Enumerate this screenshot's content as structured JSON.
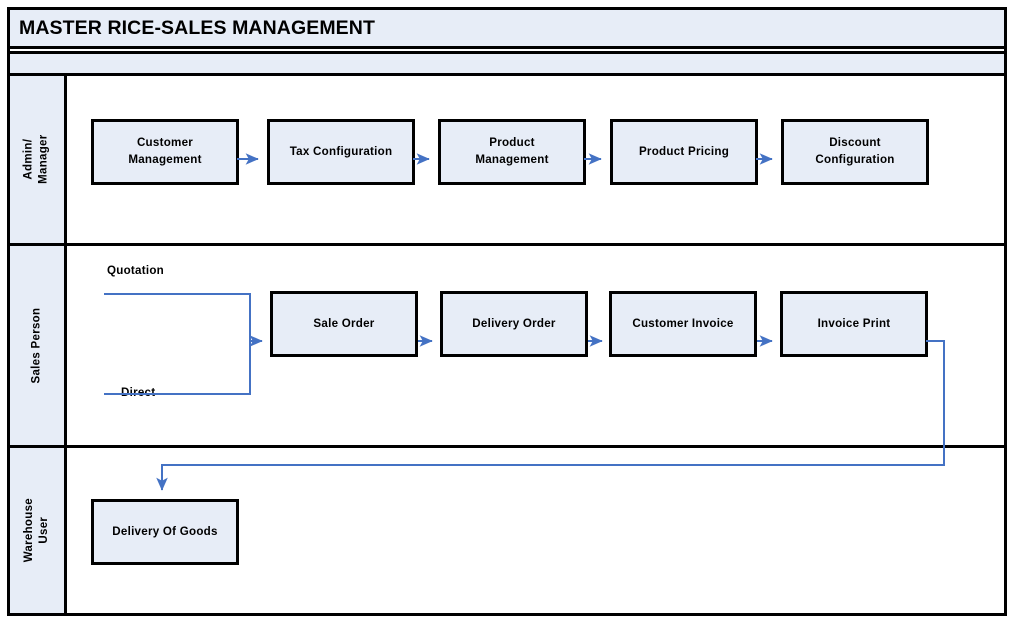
{
  "header": {
    "title": "MASTER RICE-SALES MANAGEMENT"
  },
  "colors": {
    "node_fill": "#E7EDF7",
    "node_border": "#000000",
    "connector": "#4472C4",
    "band_fill": "#E7EDF7",
    "page_background": "#FFFFFF"
  },
  "lanes": [
    {
      "id": "admin-manager",
      "label": "Admin/\nManager",
      "nodes": [
        {
          "id": "customer-management",
          "label": "Customer\nManagement"
        },
        {
          "id": "tax-configuration",
          "label": "Tax Configuration"
        },
        {
          "id": "product-management",
          "label": "Product\nManagement"
        },
        {
          "id": "product-pricing",
          "label": "Product Pricing"
        },
        {
          "id": "discount-configuration",
          "label": "Discount\nConfiguration"
        }
      ]
    },
    {
      "id": "sales-person",
      "label": "Sales Person",
      "branch_labels": [
        {
          "id": "quotation",
          "label": "Quotation"
        },
        {
          "id": "direct",
          "label": "Direct"
        }
      ],
      "nodes": [
        {
          "id": "sale-order",
          "label": "Sale Order"
        },
        {
          "id": "delivery-order",
          "label": "Delivery Order"
        },
        {
          "id": "customer-invoice",
          "label": "Customer Invoice"
        },
        {
          "id": "invoice-print",
          "label": "Invoice Print"
        }
      ]
    },
    {
      "id": "warehouse-user",
      "label": "Warehouse\nUser",
      "nodes": [
        {
          "id": "delivery-of-goods",
          "label": "Delivery Of Goods"
        }
      ]
    }
  ],
  "connectors": [
    {
      "id": "customer-management-to-tax-configuration"
    },
    {
      "id": "tax-configuration-to-product-management"
    },
    {
      "id": "product-management-to-product-pricing"
    },
    {
      "id": "product-pricing-to-discount-configuration"
    },
    {
      "id": "branch-merge-to-sale-order"
    },
    {
      "id": "sale-order-to-delivery-order"
    },
    {
      "id": "delivery-order-to-customer-invoice"
    },
    {
      "id": "customer-invoice-to-invoice-print"
    },
    {
      "id": "invoice-print-to-delivery-of-goods"
    }
  ]
}
